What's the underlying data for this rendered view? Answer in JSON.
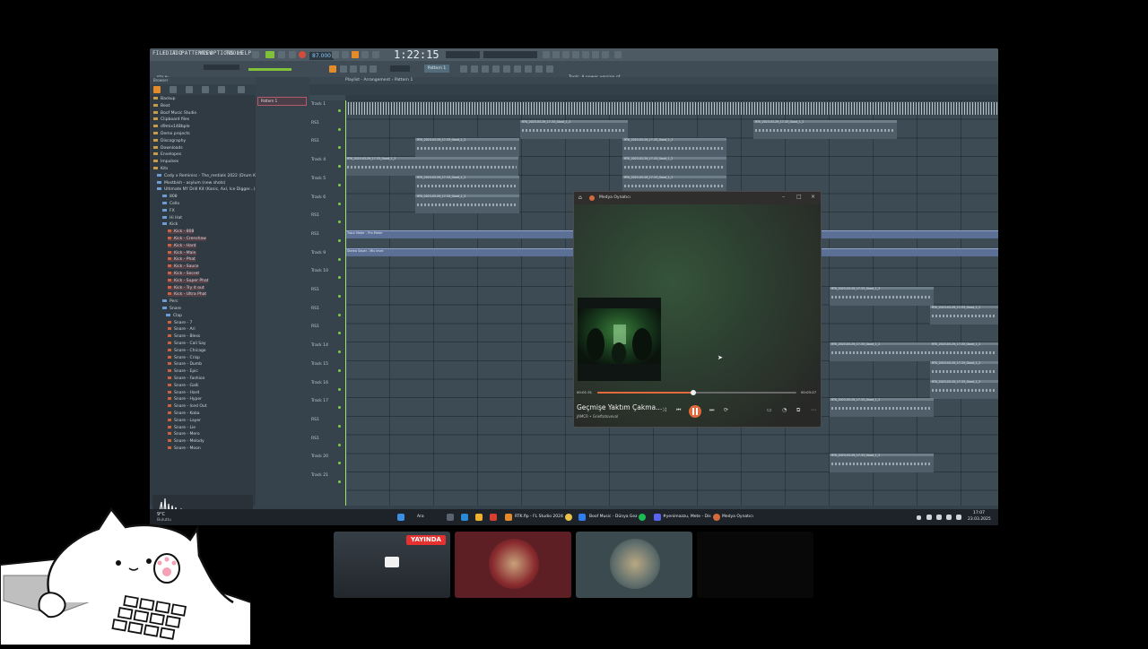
{
  "app": {
    "menu": [
      "FILE",
      "EDIT",
      "ADD",
      "PATTERNS",
      "VIEW",
      "OPTIONS",
      "TOOLS",
      "HELP"
    ],
    "tempo": "87.000",
    "time": "1:22:15",
    "hint": [
      "Tools: A newer version of",
      "FL Studio is available!"
    ],
    "info": [
      "RTK.flp",
      "28:11:14 Bar 3:34:16"
    ],
    "pattern_button": "Pattern 1"
  },
  "browser": {
    "title": "Browser",
    "items": [
      {
        "label": "Backup",
        "type": "folder"
      },
      {
        "label": "Beat",
        "type": "folder"
      },
      {
        "label": "Boof Music Studio",
        "type": "folder"
      },
      {
        "label": "Clipboard files",
        "type": "folder"
      },
      {
        "label": "d9mix14Bbple",
        "type": "folder"
      },
      {
        "label": "Demo projects",
        "type": "folder"
      },
      {
        "label": "Discography",
        "type": "folder"
      },
      {
        "label": "Downloads",
        "type": "folder"
      },
      {
        "label": "Envelopes",
        "type": "folder"
      },
      {
        "label": "Impulses",
        "type": "folder"
      },
      {
        "label": "Kits",
        "type": "folder"
      },
      {
        "label": "Cody x Reminisc - The_rentials 2022 (Drum Kit)",
        "type": "sub"
      },
      {
        "label": "Mostbish - asylum (new shots)",
        "type": "sub"
      },
      {
        "label": "Ultimate NY Drill Kit (Kanic, Axl, Ice Digger...)",
        "type": "sub"
      },
      {
        "label": "808",
        "type": "sub2"
      },
      {
        "label": "Cello",
        "type": "sub2"
      },
      {
        "label": "FX",
        "type": "sub2"
      },
      {
        "label": "Hi Hat",
        "type": "sub2"
      },
      {
        "label": "Kick",
        "type": "sub2"
      },
      {
        "label": "Kick - 808",
        "type": "file"
      },
      {
        "label": "Kick - Crenshaw",
        "type": "file"
      },
      {
        "label": "Kick - Hard",
        "type": "file"
      },
      {
        "label": "Kick - Main",
        "type": "file"
      },
      {
        "label": "Kick - Phat",
        "type": "file"
      },
      {
        "label": "Kick - Sauce",
        "type": "file"
      },
      {
        "label": "Kick - Secret",
        "type": "file"
      },
      {
        "label": "Kick - Super Phat",
        "type": "file"
      },
      {
        "label": "Kick - Try it out",
        "type": "file"
      },
      {
        "label": "Kick - Ultra Phat",
        "type": "file"
      },
      {
        "label": "Perc",
        "type": "sub2"
      },
      {
        "label": "Snare",
        "type": "sub2"
      },
      {
        "label": "Clap",
        "type": "sub3"
      },
      {
        "label": "Snare - 7",
        "type": "file"
      },
      {
        "label": "Snare - Ari",
        "type": "file"
      },
      {
        "label": "Snare - Bless",
        "type": "file"
      },
      {
        "label": "Snare - Cali Say",
        "type": "file"
      },
      {
        "label": "Snare - Chicago",
        "type": "file"
      },
      {
        "label": "Snare - Crisp",
        "type": "file"
      },
      {
        "label": "Snare - Dumb",
        "type": "file"
      },
      {
        "label": "Snare - Epic",
        "type": "file"
      },
      {
        "label": "Snare - Fashion",
        "type": "file"
      },
      {
        "label": "Snare - Galli",
        "type": "file"
      },
      {
        "label": "Snare - Hard",
        "type": "file"
      },
      {
        "label": "Snare - Hyper",
        "type": "file"
      },
      {
        "label": "Snare - Iced Out",
        "type": "file"
      },
      {
        "label": "Snare - Koba",
        "type": "file"
      },
      {
        "label": "Snare - Layer",
        "type": "file"
      },
      {
        "label": "Snare - Lie",
        "type": "file"
      },
      {
        "label": "Snare - Mero",
        "type": "file"
      },
      {
        "label": "Snare - Melody",
        "type": "file"
      },
      {
        "label": "Snare - Moon",
        "type": "file"
      }
    ]
  },
  "playlist": {
    "title": "Playlist - Arrangement › Pattern 1",
    "tracks": [
      "Track 1",
      "RS1",
      "RS1",
      "Track 4",
      "Track 5",
      "Track 6",
      "RS1",
      "RS1",
      "Track 9",
      "Track 10",
      "RS1",
      "RS1",
      "RS1",
      "Track 14",
      "Track 15",
      "Track 16",
      "Track 17",
      "RS1",
      "RS1",
      "Track 20",
      "Track 21"
    ],
    "clip_label": "RTK_2023-03-29_17-33_Good_1_2",
    "auto1": "Track Meter - Pre-Meter",
    "auto2": "Stereo Seper - Mix level"
  },
  "taskbar": {
    "weather": "9°C",
    "weather_sub": "Bulutlu",
    "search": "Ara",
    "fl": "RTK.flp - FL Studio 2024",
    "chrome": "Boof Music - Dünya Gez",
    "discord": "#yenimazzu, Mete - Dis",
    "player": "Medya Oynatıcı",
    "clock": "17:07",
    "date": "23.03.2025"
  },
  "media": {
    "title": "Medya Oynatıcı",
    "song": "Geçmişe Yaktım Çakma...",
    "artist": "JAMCR • Grieftotovoval",
    "elapsed": "00:01:31",
    "total": "00:03:27",
    "progress": 0.48
  },
  "stream": {
    "live_badge": "YAYINDA"
  }
}
